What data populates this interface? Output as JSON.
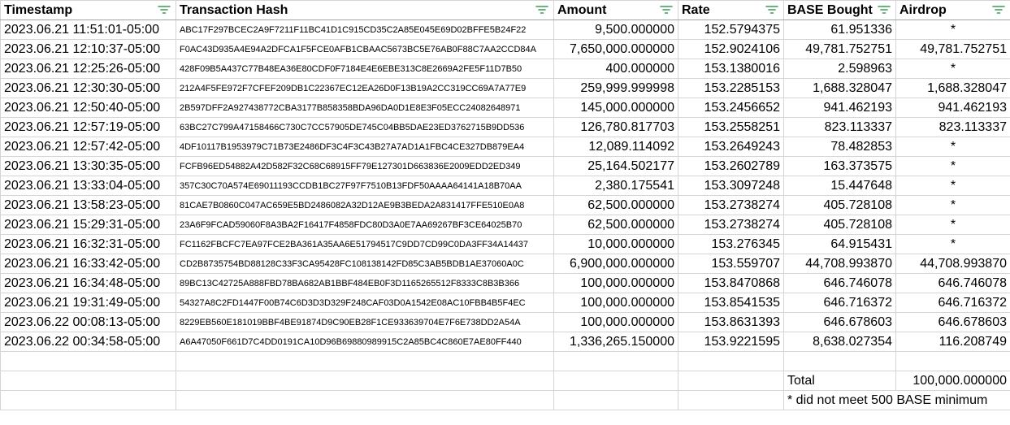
{
  "headers": {
    "timestamp": "Timestamp",
    "hash": "Transaction Hash",
    "amount": "Amount",
    "rate": "Rate",
    "base": "BASE Bought",
    "airdrop": "Airdrop"
  },
  "filter_icon_color": "#3a9b55",
  "rows": [
    {
      "ts": "2023.06.21 11:51:01-05:00",
      "hash": "ABC17F297BCEC2A9F7211F11BC41D1C915CD35C2A85E045E69D02BFFE5B24F22",
      "amount": "9,500.000000",
      "rate": "152.5794375",
      "base": "61.951336",
      "airdrop": "*"
    },
    {
      "ts": "2023.06.21 12:10:37-05:00",
      "hash": "F0AC43D935A4E94A2DFCA1F5FCE0AFB1CBAAC5673BC5E76AB0F88C7AA2CCD84A",
      "amount": "7,650,000.000000",
      "rate": "152.9024106",
      "base": "49,781.752751",
      "airdrop": "49,781.752751"
    },
    {
      "ts": "2023.06.21 12:25:26-05:00",
      "hash": "428F09B5A437C77B48EA36E80CDF0F7184E4E6EBE313C8E2669A2FE5F11D7B50",
      "amount": "400.000000",
      "rate": "153.1380016",
      "base": "2.598963",
      "airdrop": "*"
    },
    {
      "ts": "2023.06.21 12:30:30-05:00",
      "hash": "212A4F5FE972F7CFEF209DB1C22367EC12EA26D0F13B19A2CC319CC69A7A77E9",
      "amount": "259,999.999998",
      "rate": "153.2285153",
      "base": "1,688.328047",
      "airdrop": "1,688.328047"
    },
    {
      "ts": "2023.06.21 12:50:40-05:00",
      "hash": "2B597DFF2A927438772CBA3177B858358BDA96DA0D1E8E3F05ECC24082648971",
      "amount": "145,000.000000",
      "rate": "153.2456652",
      "base": "941.462193",
      "airdrop": "941.462193"
    },
    {
      "ts": "2023.06.21 12:57:19-05:00",
      "hash": "63BC27C799A47158466C730C7CC57905DE745C04BB5DAE23ED3762715B9DD536",
      "amount": "126,780.817703",
      "rate": "153.2558251",
      "base": "823.113337",
      "airdrop": "823.113337"
    },
    {
      "ts": "2023.06.21 12:57:42-05:00",
      "hash": "4DF10117B1953979C71B73E2486DF3C4F3C43B27A7AD1A1FBC4CE327DB879EA4",
      "amount": "12,089.114092",
      "rate": "153.2649243",
      "base": "78.482853",
      "airdrop": "*"
    },
    {
      "ts": "2023.06.21 13:30:35-05:00",
      "hash": "FCFB96ED54882A42D582F32C68C68915FF79E127301D663836E2009EDD2ED349",
      "amount": "25,164.502177",
      "rate": "153.2602789",
      "base": "163.373575",
      "airdrop": "*"
    },
    {
      "ts": "2023.06.21 13:33:04-05:00",
      "hash": "357C30C70A574E69011193CCDB1BC27F97F7510B13FDF50AAAA64141A18B70AA",
      "amount": "2,380.175541",
      "rate": "153.3097248",
      "base": "15.447648",
      "airdrop": "*"
    },
    {
      "ts": "2023.06.21 13:58:23-05:00",
      "hash": "81CAE7B0860C047AC659E5BD2486082A32D12AE9B3BEDA2A831417FFE510E0A8",
      "amount": "62,500.000000",
      "rate": "153.2738274",
      "base": "405.728108",
      "airdrop": "*"
    },
    {
      "ts": "2023.06.21 15:29:31-05:00",
      "hash": "23A6F9FCAD59060F8A3BA2F16417F4858FDC80D3A0E7AA69267BF3CE64025B70",
      "amount": "62,500.000000",
      "rate": "153.2738274",
      "base": "405.728108",
      "airdrop": "*"
    },
    {
      "ts": "2023.06.21 16:32:31-05:00",
      "hash": "FC1162FBCFC7EA97FCE2BA361A35AA6E51794517C9DD7CD99C0DA3FF34A14437",
      "amount": "10,000.000000",
      "rate": "153.276345",
      "base": "64.915431",
      "airdrop": "*"
    },
    {
      "ts": "2023.06.21 16:33:42-05:00",
      "hash": "CD2B8735754BD88128C33F3CA95428FC108138142FD85C3AB5BDB1AE37060A0C",
      "amount": "6,900,000.000000",
      "rate": "153.559707",
      "base": "44,708.993870",
      "airdrop": "44,708.993870"
    },
    {
      "ts": "2023.06.21 16:34:48-05:00",
      "hash": "89BC13C42725A888FBD78BA682AB1BBF484EB0F3D1165265512F8333C8B3B366",
      "amount": "100,000.000000",
      "rate": "153.8470868",
      "base": "646.746078",
      "airdrop": "646.746078"
    },
    {
      "ts": "2023.06.21 19:31:49-05:00",
      "hash": "54327A8C2FD1447F00B74C6D3D3D329F248CAF03D0A1542E08AC10FBB4B5F4EC",
      "amount": "100,000.000000",
      "rate": "153.8541535",
      "base": "646.716372",
      "airdrop": "646.716372"
    },
    {
      "ts": "2023.06.22 00:08:13-05:00",
      "hash": "8229EB560E181019BBF4BE91874D9C90EB28F1CE933639704E7F6E738DD2A54A",
      "amount": "100,000.000000",
      "rate": "153.8631393",
      "base": "646.678603",
      "airdrop": "646.678603"
    },
    {
      "ts": "2023.06.22 00:34:58-05:00",
      "hash": "A6A47050F661D7C4DD0191CA10D96B69880989915C2A85BC4C860E7AE80FF440",
      "amount": "1,336,265.150000",
      "rate": "153.9221595",
      "base": "8,638.027354",
      "airdrop": "116.208749"
    }
  ],
  "footer": {
    "total_label": "Total",
    "total_value": "100,000.000000",
    "note": "* did not meet 500 BASE minimum"
  }
}
